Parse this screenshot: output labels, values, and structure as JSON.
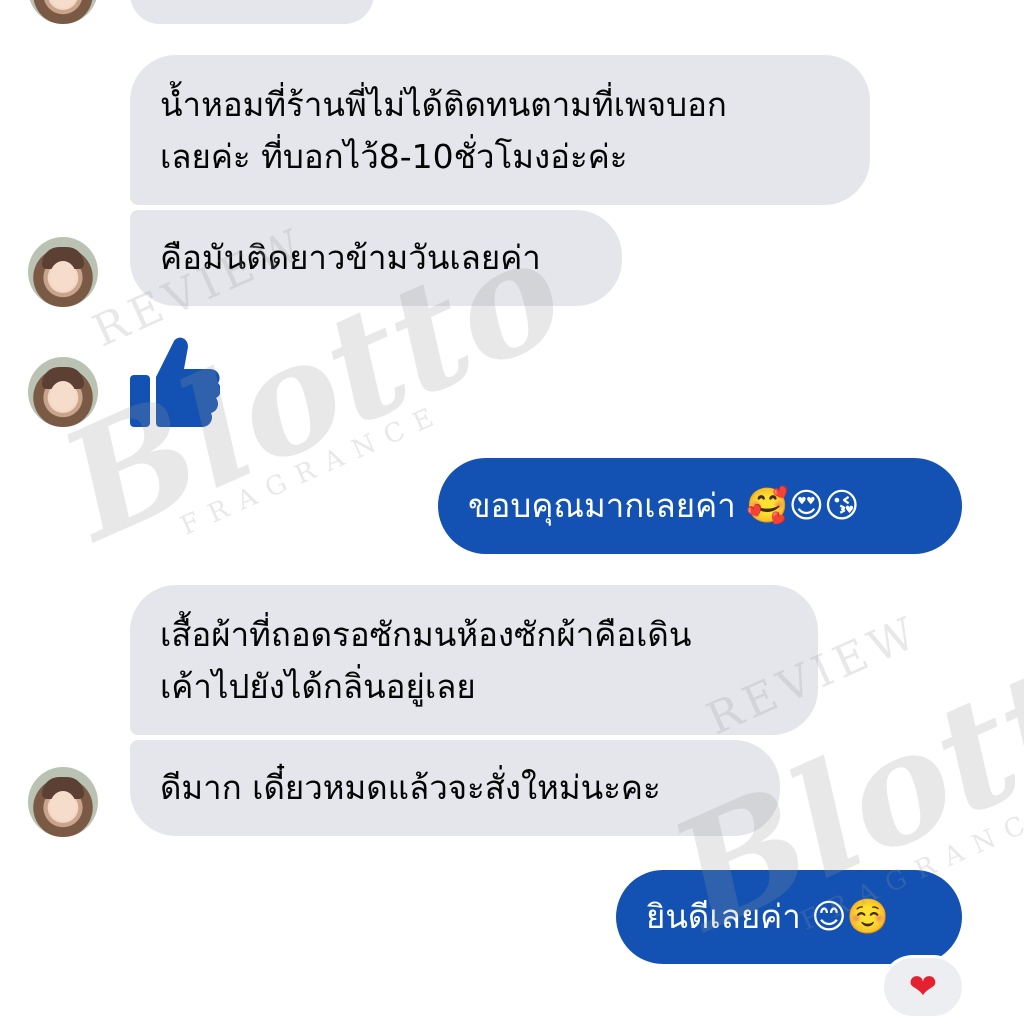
{
  "messages": {
    "m0": {
      "text": ""
    },
    "m1": {
      "line1": "น้ำหอมที่ร้านพี่ไม่ได้ติดทนตามที่เพจบอก",
      "line2": "เลยค่ะ  ที่บอกไว้8-10ชั่วโมงอ่ะค่ะ"
    },
    "m2": {
      "text": "คือมันติดยาวข้ามวันเลยค่า"
    },
    "m3": {
      "reaction": "thumbs-up-icon"
    },
    "m4": {
      "text": "ขอบคุณมากเลยค่า",
      "emojis": "🥰😍😘"
    },
    "m5": {
      "line1": "เสื้อผ้าที่ถอดรอซักมนห้องซักผ้าคือเดิน",
      "line2": "เค้าไปยังได้กลิ่นอยู่เลย"
    },
    "m6": {
      "text": "ดีมาก  เดี๋ยวหมดแล้วจะสั่งใหม่นะคะ"
    },
    "m7": {
      "text": "ยินดีเลยค่า",
      "emojis": "😊☺️"
    }
  },
  "reaction_badge": {
    "emoji": "❤"
  },
  "watermark": {
    "top": "REVIEW",
    "brand": "Blotto",
    "bottom": "FRAGRANCE"
  },
  "colors": {
    "incoming_bubble": "#e4e6eb",
    "outgoing_bubble": "#1352b2",
    "thumb": "#1352b2",
    "heart": "#e4222f"
  }
}
